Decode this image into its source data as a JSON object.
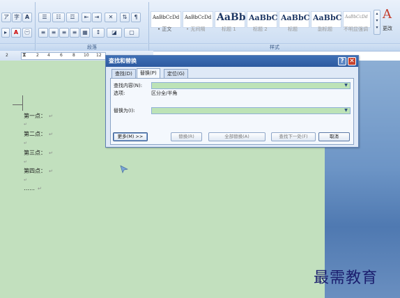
{
  "ribbon": {
    "paragraph_group_label": "段落",
    "styles_group_label": "样式",
    "styles": [
      {
        "sample": "AaBbCcDd",
        "name": "• 正文"
      },
      {
        "sample": "AaBbCcDd",
        "name": "• 无间隔"
      },
      {
        "sample": "AaBb",
        "name": "标题 1"
      },
      {
        "sample": "AaBbC",
        "name": "标题 2"
      },
      {
        "sample": "AaBbC",
        "name": "标题"
      },
      {
        "sample": "AaBbC",
        "name": "副标题"
      },
      {
        "sample": "AaBbCcDd",
        "name": "不明显强调"
      }
    ],
    "change_styles_label": "更改",
    "font_buttons": [
      "A",
      "A",
      "A"
    ]
  },
  "ruler": {
    "ticks": [
      "2",
      "2",
      "4",
      "6",
      "8",
      "10",
      "12"
    ]
  },
  "document": {
    "lines": [
      "第一点：",
      "第二点：",
      "第三点：",
      "第四点：",
      "……"
    ],
    "paragraph_mark": "↵"
  },
  "dialog": {
    "title": "查找和替换",
    "help_label": "?",
    "close_label": "✕",
    "tabs": [
      "查找(D)",
      "替换(P)",
      "定位(G)"
    ],
    "active_tab": "替换(P)",
    "find_label": "查找内容(N):",
    "find_value": "",
    "options_label": "选项:",
    "options_value": "区分全/半角",
    "replace_label": "替换为(I):",
    "replace_value": "",
    "buttons": {
      "more": "更多(M) >>",
      "replace": "替换(R)",
      "replace_all": "全部替换(A)",
      "find_next": "查找下一处(F)",
      "cancel": "取消"
    }
  },
  "watermark": "最需教育"
}
